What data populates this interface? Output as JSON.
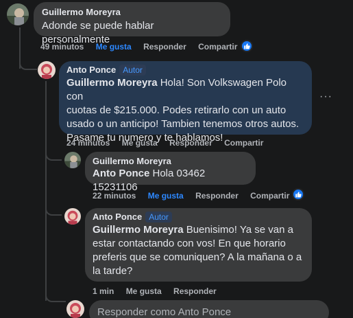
{
  "comments": [
    {
      "author": "Guillermo Moreyra",
      "text": "Adonde se puede hablar personalmente",
      "time": "49 minutos",
      "like": "Me gusta",
      "reply": "Responder",
      "share": "Compartir"
    },
    {
      "author": "Anto Ponce",
      "badge": "Autor",
      "mention": "Guillermo Moreyra",
      "text_lines": [
        " Hola! Son Volkswagen Polo con",
        "cuotas de $215.000. Podes retirarlo con un auto",
        "usado o un anticipo! Tambien tenemos otros autos.",
        "Pasame tu numero y te hablamos!"
      ],
      "time": "24 minutos",
      "like": "Me gusta",
      "reply": "Responder",
      "share": "Compartir",
      "more": "···"
    },
    {
      "author": "Guillermo Moreyra",
      "mention": "Anto Ponce",
      "text": " Hola 03462 15231106",
      "time": "22 minutos",
      "like": "Me gusta",
      "reply": "Responder",
      "share": "Compartir"
    },
    {
      "author": "Anto Ponce",
      "badge": "Autor",
      "mention": "Guillermo Moreyra",
      "text_lines": [
        " Buenisimo! Ya se van a",
        "estar contactando con vos! En que horario",
        "preferis que se comuniquen? A la mañana o a",
        "la tarde?"
      ],
      "time": "1 min",
      "like": "Me gusta",
      "reply": "Responder"
    }
  ],
  "reply_input": {
    "placeholder": "Responder como Anto Ponce"
  },
  "icons": {
    "like_badge": "thumbs-up-icon",
    "more": "more-options-icon"
  },
  "colors": {
    "background": "#18191a",
    "bubble": "#3a3b3c",
    "highlight_bubble": "#263951",
    "link_blue": "#2d88ff"
  }
}
